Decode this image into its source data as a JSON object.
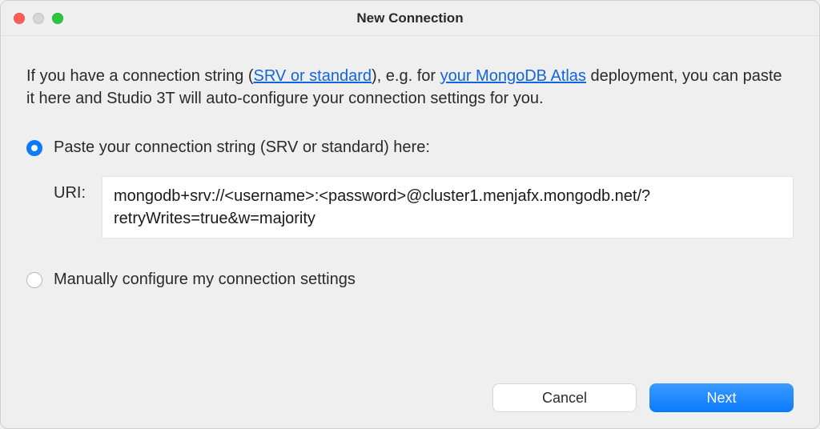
{
  "window": {
    "title": "New Connection"
  },
  "intro": {
    "pre": "If you have a connection string (",
    "link1": "SRV or standard",
    "mid": "), e.g. for ",
    "link2": "your MongoDB Atlas",
    "post": " deployment, you can paste it here and Studio 3T will auto-configure your connection settings for you."
  },
  "options": {
    "paste_label": "Paste your connection string (SRV or standard) here:",
    "manual_label": "Manually configure my connection settings"
  },
  "uri": {
    "label": "URI:",
    "value": "mongodb+srv://<username>:<password>@cluster1.menjafx.mongodb.net/?retryWrites=true&w=majority"
  },
  "buttons": {
    "cancel": "Cancel",
    "next": "Next"
  }
}
